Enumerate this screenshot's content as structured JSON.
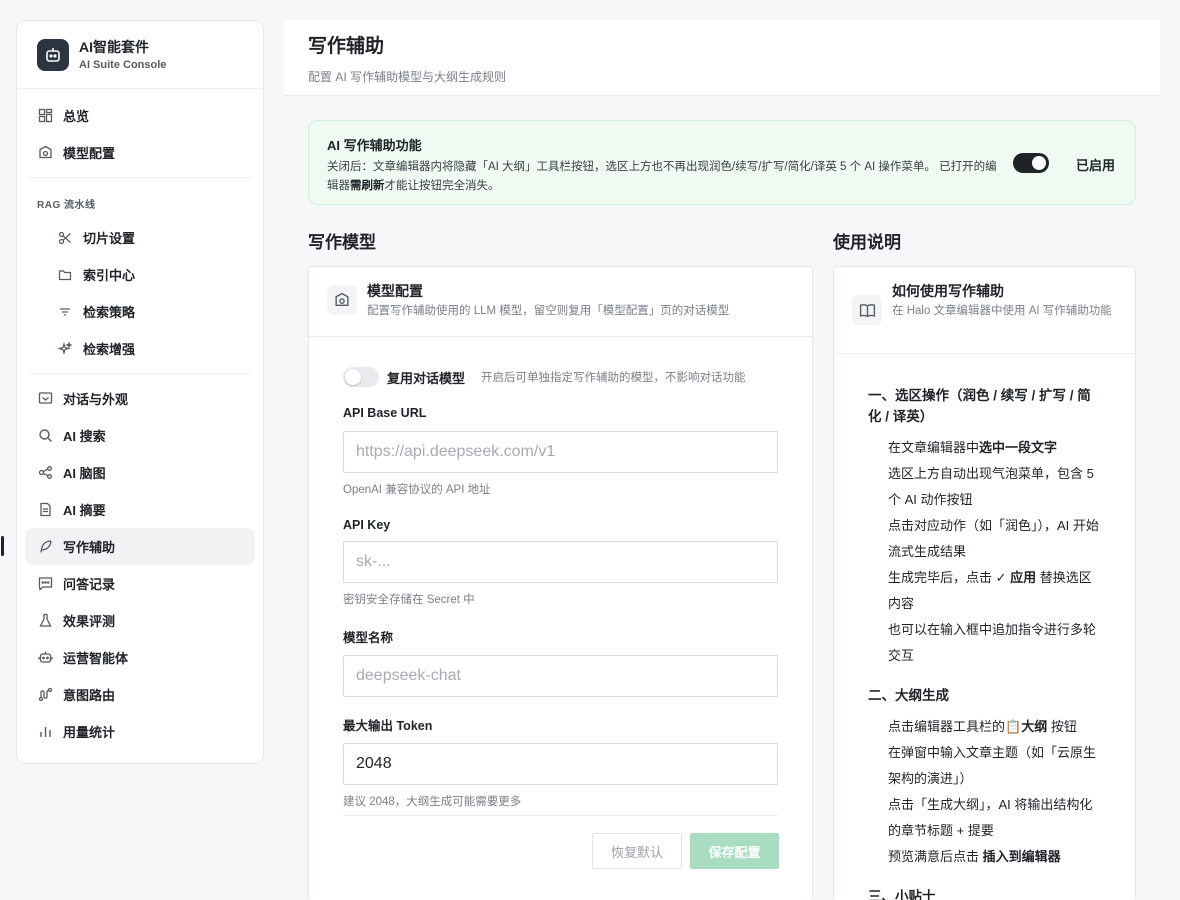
{
  "brand": {
    "title": "AI智能套件",
    "subtitle": "AI Suite Console"
  },
  "nav": {
    "overview": "总览",
    "model_config": "模型配置",
    "rag_group": "RAG 流水线",
    "chunk": "切片设置",
    "index": "索引中心",
    "retrieval": "检索策略",
    "enhance": "检索增强",
    "chat": "对话与外观",
    "search": "AI 搜索",
    "mindmap": "AI 脑图",
    "summary": "AI 摘要",
    "writing": "写作辅助",
    "qa": "问答记录",
    "eval": "效果评测",
    "agent": "运营智能体",
    "route": "意图路由",
    "usage": "用量统计"
  },
  "header": {
    "title": "写作辅助",
    "subtitle": "配置 AI 写作辅助模型与大纲生成规则"
  },
  "banner": {
    "title": "AI 写作辅助功能",
    "text_prefix": "关闭后：文章编辑器内将隐藏「AI 大纲」工具栏按钮，选区上方也不再出现润色/续写/扩写/简化/译英 5 个 AI 操作菜单。 已打开的编辑器",
    "text_bold": "需刷新",
    "text_suffix": "才能让按钮完全消失。",
    "toggle_label": "已启用"
  },
  "sections": {
    "model": "写作模型",
    "usage": "使用说明"
  },
  "model_card": {
    "title": "模型配置",
    "subtitle": "配置写作辅助使用的 LLM 模型，留空则复用「模型配置」页的对话模型",
    "reuse_label": "复用对话模型",
    "reuse_hint": "开启后可单独指定写作辅助的模型，不影响对话功能",
    "base_url_label": "API Base URL",
    "base_url_placeholder": "https://api.deepseek.com/v1",
    "base_url_hint": "OpenAI 兼容协议的 API 地址",
    "api_key_label": "API Key",
    "api_key_placeholder": "sk-...",
    "api_key_hint": "密钥安全存储在 Secret 中",
    "model_name_label": "模型名称",
    "model_name_placeholder": "deepseek-chat",
    "max_token_label": "最大输出 Token",
    "max_token_value": "2048",
    "max_token_hint": "建议 2048，大纲生成可能需要更多",
    "reset_label": "恢复默认",
    "save_label": "保存配置"
  },
  "usage_card": {
    "title": "如何使用写作辅助",
    "subtitle": "在 Halo 文章编辑器中使用 AI 写作辅助功能",
    "s1_title": "一、选区操作（润色 / 续写 / 扩写 / 简化 / 译英）",
    "s1_l1_a": "在文章编辑器中",
    "s1_l1_b": "选中一段文字",
    "s1_l2": "选区上方自动出现气泡菜单，包含 5 个 AI 动作按钮",
    "s1_l3": "点击对应动作（如「润色」），AI 开始流式生成结果",
    "s1_l4_a": "生成完毕后，点击",
    "s1_l4_b": "✓ 应用",
    "s1_l4_c": "替换选区内容",
    "s1_l5": "也可以在输入框中追加指令进行多轮交互",
    "s2_title": "二、大纲生成",
    "s2_l1_a": "点击编辑器工具栏的",
    "s2_l1_b": "📋大纲",
    "s2_l1_c": "按钮",
    "s2_l2": "在弹窗中输入文章主题（如「云原生架构的演进」）",
    "s2_l3": "点击「生成大纲」，AI 将输出结构化的章节标题 + 提要",
    "s2_l4_a": "预览满意后点击",
    "s2_l4_b": "插入到编辑器",
    "s3_title": "三、小贴士"
  }
}
